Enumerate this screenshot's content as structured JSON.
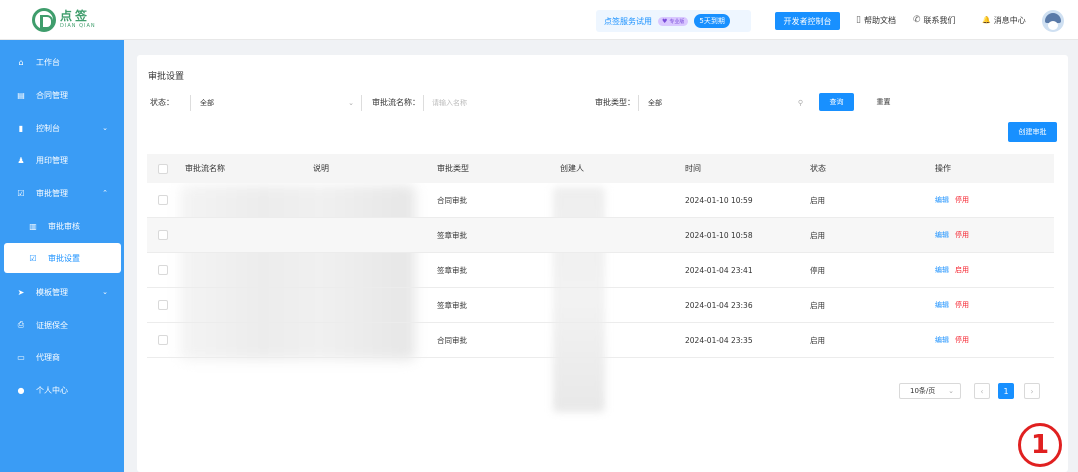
{
  "header": {
    "logo_cn": "点签",
    "logo_en": "DIAN QIAN",
    "trial_text": "点签服务试用",
    "trial_badge": "专业版",
    "trial_days": "5天到期",
    "dev_console": "开发者控制台",
    "links": [
      {
        "icon": "book-icon",
        "glyph": "▯",
        "label": "帮助文档"
      },
      {
        "icon": "phone-icon",
        "glyph": "✆",
        "label": "联系我们"
      },
      {
        "icon": "bell-icon",
        "glyph": "🔔",
        "label": "消息中心"
      }
    ]
  },
  "sidebar": {
    "items": [
      {
        "label": "工作台",
        "glyph": "⌂",
        "icon": "home-icon"
      },
      {
        "label": "合同管理",
        "glyph": "▤",
        "icon": "contract-icon"
      },
      {
        "label": "控制台",
        "glyph": "▮",
        "icon": "chart-icon",
        "chevron": "⌄"
      },
      {
        "label": "用印管理",
        "glyph": "♟",
        "icon": "seal-icon"
      },
      {
        "label": "审批管理",
        "glyph": "☑",
        "icon": "approval-icon",
        "chevron": "⌃"
      },
      {
        "label": "审批审核",
        "glyph": "▥",
        "icon": "review-icon",
        "sub": true
      },
      {
        "label": "审批设置",
        "glyph": "☑",
        "icon": "settings-check-icon",
        "sub": true,
        "active": true
      },
      {
        "label": "模板管理",
        "glyph": "➤",
        "icon": "template-icon",
        "chevron": "⌄"
      },
      {
        "label": "证据保全",
        "glyph": "⎙",
        "icon": "evidence-icon"
      },
      {
        "label": "代理商",
        "glyph": "▭",
        "icon": "agent-icon"
      },
      {
        "label": "个人中心",
        "glyph": "●",
        "icon": "user-icon"
      }
    ]
  },
  "page": {
    "title": "审批设置",
    "filters": {
      "status_label": "状态：",
      "status_value": "全部",
      "flow_name_label": "审批流名称：",
      "flow_name_placeholder": "请输入名称",
      "type_label": "审批类型：",
      "type_value": "全部",
      "query_button": "查询",
      "reset_button": "重置"
    },
    "new_button": "创建审批"
  },
  "table": {
    "columns": [
      "审批流名称",
      "说明",
      "审批类型",
      "创建人",
      "时间",
      "状态",
      "操作"
    ],
    "rows": [
      {
        "name": "",
        "desc": "",
        "type": "合同审批",
        "creator": "",
        "time": "2024-01-10 10:59",
        "status": "启用",
        "ops": [
          "编辑",
          "停用"
        ]
      },
      {
        "name": "",
        "desc": "",
        "type": "签章审批",
        "creator": "",
        "time": "2024-01-10 10:58",
        "status": "启用",
        "ops": [
          "编辑",
          "停用"
        ]
      },
      {
        "name": "",
        "desc": "",
        "type": "签章审批",
        "creator": "",
        "time": "2024-01-04 23:41",
        "status": "停用",
        "ops": [
          "编辑",
          "启用"
        ]
      },
      {
        "name": "",
        "desc": "",
        "type": "签章审批",
        "creator": "",
        "time": "2024-01-04 23:36",
        "status": "启用",
        "ops": [
          "编辑",
          "停用"
        ]
      },
      {
        "name": "",
        "desc": "",
        "type": "合同审批",
        "creator": "",
        "time": "2024-01-04 23:35",
        "status": "启用",
        "ops": [
          "编辑",
          "停用"
        ]
      }
    ]
  },
  "pagination": {
    "page_size": "10条/页",
    "prev": "‹",
    "current": "1",
    "next": "›"
  },
  "annotation": "1",
  "colors": {
    "sidebar": "#3a9cf5",
    "primary": "#1890ff",
    "danger": "#f5222d",
    "brand": "#3f9d6c"
  }
}
